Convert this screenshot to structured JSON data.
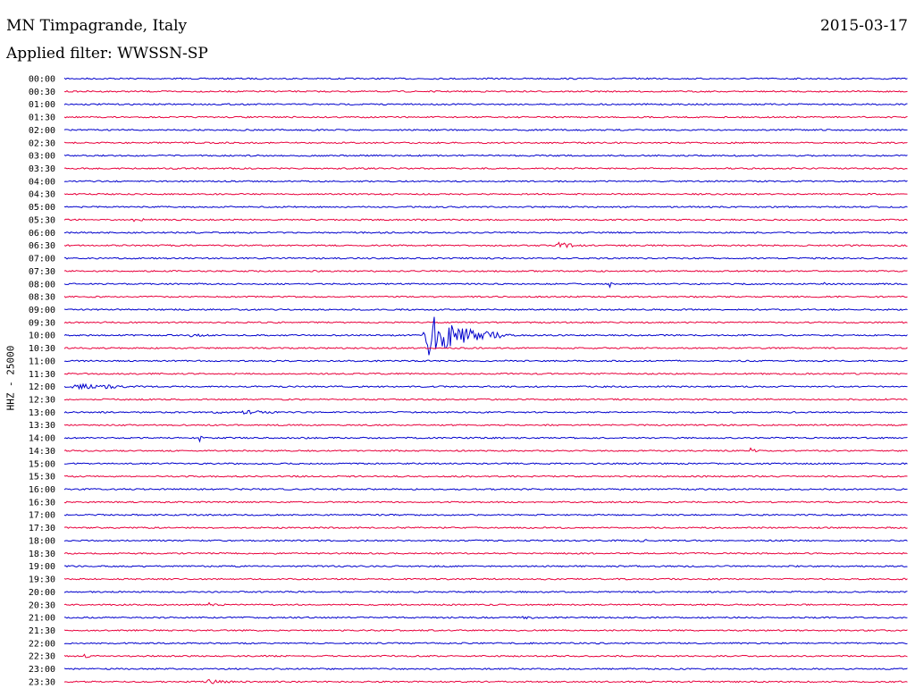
{
  "header": {
    "station": "MN Timpagrande, Italy",
    "date": "2015-03-17",
    "filter": "Applied filter: WWSSN-SP"
  },
  "chart_data": {
    "type": "line",
    "title": "MN Timpagrande, Italy",
    "ylabel": "HHZ - 25000",
    "row_labels": [
      "00:00",
      "00:30",
      "01:00",
      "01:30",
      "02:00",
      "02:30",
      "03:00",
      "03:30",
      "04:00",
      "04:30",
      "05:00",
      "05:30",
      "06:00",
      "06:30",
      "07:00",
      "07:30",
      "08:00",
      "08:30",
      "09:00",
      "09:30",
      "10:00",
      "10:30",
      "11:00",
      "11:30",
      "12:00",
      "12:30",
      "13:00",
      "13:30",
      "14:00",
      "14:30",
      "15:00",
      "15:30",
      "16:00",
      "16:30",
      "17:00",
      "17:30",
      "18:00",
      "18:30",
      "19:00",
      "19:30",
      "20:00",
      "20:30",
      "21:00",
      "21:30",
      "22:00",
      "22:30",
      "23:00",
      "23:30"
    ],
    "colors": [
      "#0000cc",
      "#e8003c"
    ],
    "row_minutes": 30,
    "events": [
      {
        "row": 11,
        "minute": 2.5,
        "amp": 3,
        "dur": 0.6
      },
      {
        "row": 13,
        "minute": 17.5,
        "amp": 3.5,
        "dur": 1.4
      },
      {
        "row": 16,
        "minute": 19.4,
        "amp": 3,
        "dur": 0.15
      },
      {
        "row": 16,
        "minute": 27.0,
        "amp": 2.5,
        "dur": 0.15
      },
      {
        "row": 20,
        "minute": 12.8,
        "amp": 29,
        "dur": 3.2
      },
      {
        "row": 20,
        "minute": 14.5,
        "amp": 5,
        "dur": 1.4
      },
      {
        "row": 20,
        "minute": 4.5,
        "amp": 2,
        "dur": 0.8
      },
      {
        "row": 24,
        "minute": 0.3,
        "amp": 4,
        "dur": 2.0
      },
      {
        "row": 24,
        "minute": 1.4,
        "amp": 3,
        "dur": 1.2
      },
      {
        "row": 26,
        "minute": 5.3,
        "amp": 2,
        "dur": 0.6
      },
      {
        "row": 26,
        "minute": 6.3,
        "amp": 2.5,
        "dur": 1.5
      },
      {
        "row": 28,
        "minute": 4.8,
        "amp": 4,
        "dur": 0.2
      },
      {
        "row": 28,
        "minute": 8.5,
        "amp": 2,
        "dur": 0.2
      },
      {
        "row": 29,
        "minute": 24.4,
        "amp": 3,
        "dur": 0.3
      },
      {
        "row": 36,
        "minute": 20.5,
        "amp": 2,
        "dur": 0.5
      },
      {
        "row": 41,
        "minute": 5.1,
        "amp": 2,
        "dur": 0.7
      },
      {
        "row": 42,
        "minute": 16.3,
        "amp": 1.5,
        "dur": 0.6
      },
      {
        "row": 45,
        "minute": 0.7,
        "amp": 2,
        "dur": 0.5
      },
      {
        "row": 47,
        "minute": 5.0,
        "amp": 2.5,
        "dur": 1.5
      }
    ]
  }
}
